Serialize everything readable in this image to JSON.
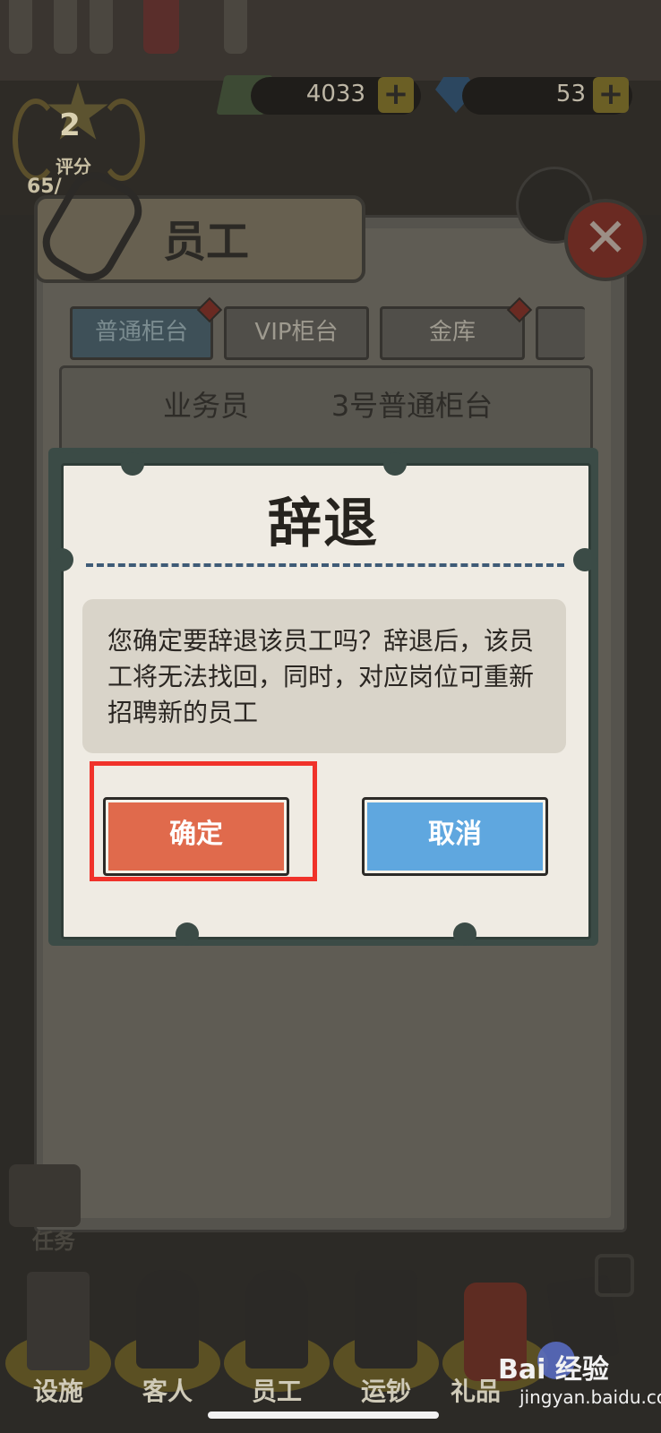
{
  "hud": {
    "score_number": "2",
    "score_label": "评分",
    "score_value": "65/",
    "cash": "4033",
    "gems": "53",
    "plus": "+"
  },
  "panel": {
    "title": "员工",
    "close_symbol": "✕",
    "tabs": [
      {
        "label": "普通柜台",
        "active": true
      },
      {
        "label": "VIP柜台",
        "active": false
      },
      {
        "label": "金库",
        "active": false
      },
      {
        "label": "",
        "active": false
      }
    ],
    "staff": {
      "role": "业务员",
      "seat": "3号普通柜台"
    }
  },
  "dialog": {
    "title": "辞退",
    "message": "您确定要辞退该员工吗？辞退后，该员工将无法找回，同时，对应岗位可重新招聘新的员工",
    "confirm_label": "确定",
    "cancel_label": "取消"
  },
  "bottom_nav": [
    {
      "label": "设施"
    },
    {
      "label": "客人"
    },
    {
      "label": "员工"
    },
    {
      "label": "运钞"
    },
    {
      "label": "礼品"
    }
  ],
  "bottom_left_label": "任务",
  "watermark": {
    "brand": "Bai  经验",
    "url": "jingyan.baidu.com"
  },
  "colors": {
    "confirm": "#e06a4c",
    "cancel": "#5fa7df",
    "highlight": "#f0322a",
    "dash": "#3f5b77"
  }
}
